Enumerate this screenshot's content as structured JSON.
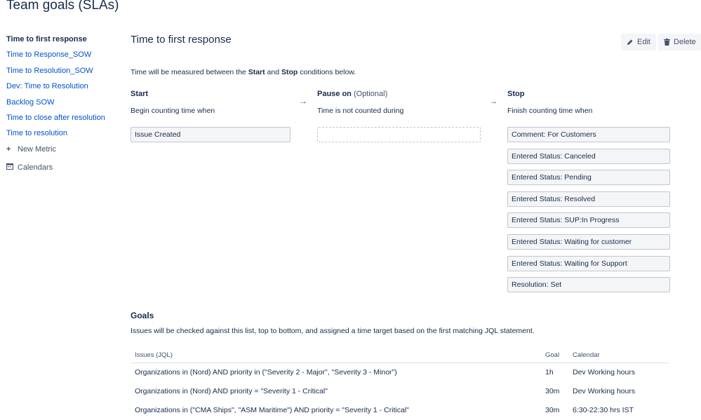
{
  "page_title": "Team goals (SLAs)",
  "sidebar": {
    "items": [
      {
        "label": "Time to first response",
        "active": true
      },
      {
        "label": "Time to Response_SOW"
      },
      {
        "label": "Time to Resolution_SOW"
      },
      {
        "label": "Dev: Time to Resolution"
      },
      {
        "label": "Backlog SOW"
      },
      {
        "label": "Time to close after resolution"
      },
      {
        "label": "Time to resolution"
      }
    ],
    "new_metric_label": "New Metric",
    "calendars_label": "Calendars"
  },
  "metric": {
    "title": "Time to first response",
    "edit_label": "Edit",
    "delete_label": "Delete",
    "description_prefix": "Time will be measured between the ",
    "description_start": "Start",
    "description_and": " and ",
    "description_stop": "Stop",
    "description_suffix": " conditions below."
  },
  "columns": {
    "start": {
      "title": "Start",
      "subtitle": "Begin counting time when",
      "conditions": [
        "Issue Created"
      ]
    },
    "pause": {
      "title": "Pause on",
      "optional": "(Optional)",
      "subtitle": "Time is not counted during",
      "conditions": []
    },
    "stop": {
      "title": "Stop",
      "subtitle": "Finish counting time when",
      "conditions": [
        "Comment: For Customers",
        "Entered Status: Canceled",
        "Entered Status: Pending",
        "Entered Status: Resolved",
        "Entered Status: SUP:In Progress",
        "Entered Status: Waiting for customer",
        "Entered Status: Waiting for Support",
        "Resolution: Set"
      ]
    },
    "arrow": "→"
  },
  "goals": {
    "title": "Goals",
    "description": "Issues will be checked against this list, top to bottom, and assigned a time target based on the first matching JQL statement.",
    "headers": {
      "issues": "Issues",
      "jql": "(JQL)",
      "goal": "Goal",
      "calendar": "Calendar"
    },
    "rows": [
      {
        "issues": "Organizations in (Nord) AND priority in (\"Severity 2 - Major\", \"Severity 3 - Minor\")",
        "goal": "1h",
        "calendar": "Dev Working hours"
      },
      {
        "issues": "Organizations in (Nord) AND priority = \"Severity 1 - Critical\"",
        "goal": "30m",
        "calendar": "Dev Working hours"
      },
      {
        "issues": "Organizations in (\"CMA Ships\", \"ASM Maritime\") AND priority = \"Severity 1 - Critical\"",
        "goal": "30m",
        "calendar": "6:30-22:30 hrs IST"
      }
    ]
  },
  "icons": {
    "new_metric": "plus-icon",
    "calendars": "calendar-icon",
    "edit": "pencil-icon",
    "delete": "trash-icon"
  },
  "colors": {
    "link": "#0052cc",
    "text": "#172b4d",
    "condition_bg": "#f4f5f7",
    "condition_border": "#c1c7d0"
  }
}
